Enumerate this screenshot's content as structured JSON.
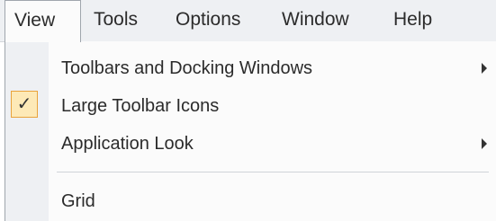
{
  "menubar": {
    "items": [
      {
        "label": "View"
      },
      {
        "label": "Tools"
      },
      {
        "label": "Options"
      },
      {
        "label": "Window"
      },
      {
        "label": "Help"
      }
    ]
  },
  "dropdown": {
    "items": [
      {
        "label": "Toolbars and Docking Windows",
        "has_submenu": true,
        "checked": false
      },
      {
        "label": "Large Toolbar Icons",
        "has_submenu": false,
        "checked": true,
        "check_glyph": "✓"
      },
      {
        "label": "Application Look",
        "has_submenu": true,
        "checked": false
      },
      {
        "label": "Grid",
        "has_submenu": false,
        "checked": false
      }
    ]
  },
  "colors": {
    "menubar_bg": "#eef0f3",
    "check_highlight": "#fde9b7",
    "check_border": "#e9a33c"
  },
  "icons": {
    "submenu_arrow": "chevron-right-icon",
    "check": "checkmark-icon"
  }
}
